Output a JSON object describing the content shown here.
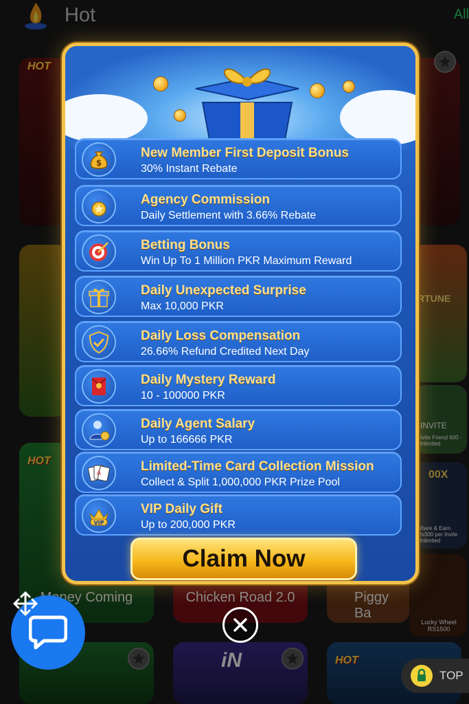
{
  "header": {
    "title": "Hot",
    "all_link": "All"
  },
  "background_cards": {
    "card1_label": "Money Coming",
    "card2_label": "Chicken Road 2.0",
    "card3_label": "Piggy Ba",
    "hot_tag": "HOT",
    "side_banners": {
      "fortune_label": "RTUNE",
      "invite_badge": "INVITE",
      "invite_text": "Invite Friend 600 · Unlimited",
      "multiplier_text": "00X",
      "share_text": "Share & Earn Rs300 per Invite Unlimited",
      "wheel_text": "Lucky Wheel RS1500"
    },
    "bottom_brand": "iN"
  },
  "promo_popup": {
    "perks": [
      {
        "title": "New Member First Deposit Bonus",
        "subtitle": "30% Instant Rebate",
        "icon": "money-bag-icon"
      },
      {
        "title": "Agency Commission",
        "subtitle": "Daily Settlement with 3.66% Rebate",
        "icon": "medal-icon"
      },
      {
        "title": "Betting Bonus",
        "subtitle": "Win Up To 1 Million PKR Maximum Reward",
        "icon": "target-icon"
      },
      {
        "title": "Daily Unexpected Surprise",
        "subtitle": "Max 10,000 PKR",
        "icon": "gift-box-icon"
      },
      {
        "title": "Daily Loss Compensation",
        "subtitle": "26.66% Refund Credited Next Day",
        "icon": "shield-check-icon"
      },
      {
        "title": "Daily Mystery Reward",
        "subtitle": "10 - 100000 PKR",
        "icon": "red-envelope-icon"
      },
      {
        "title": "Daily Agent Salary",
        "subtitle": "Up to 166666 PKR",
        "icon": "agent-icon"
      },
      {
        "title": "Limited-Time Card Collection Mission",
        "subtitle": "Collect & Split 1,000,000 PKR Prize Pool",
        "icon": "playing-cards-icon"
      },
      {
        "title": "VIP Daily Gift",
        "subtitle": "Up to 200,000 PKR",
        "icon": "vip-crown-icon"
      }
    ],
    "vip_badge": "VIP",
    "claim_button": "Claim Now"
  },
  "floating": {
    "top_button": "TOP"
  },
  "colors": {
    "accent_gold": "#f2c24a",
    "popup_blue": "#1d56b6",
    "chat_blue": "#1a78f0",
    "all_green": "#2fd36b"
  }
}
